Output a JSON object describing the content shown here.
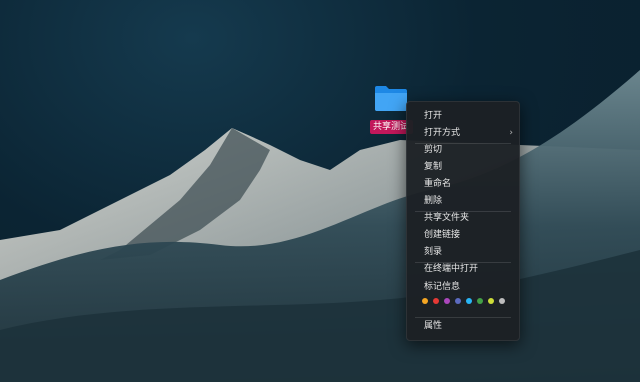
{
  "desktop": {
    "file": {
      "icon": "folder-icon",
      "label": "共享测试"
    }
  },
  "context_menu": {
    "items": [
      {
        "label": "打开"
      },
      {
        "label": "打开方式",
        "has_submenu": true,
        "submenu_icon": "chevron-right-icon"
      },
      {
        "label": "剪切"
      },
      {
        "label": "复制"
      },
      {
        "label": "重命名"
      },
      {
        "label": "删除"
      },
      {
        "label": "共享文件夹"
      },
      {
        "label": "创建链接"
      },
      {
        "label": "刻录"
      },
      {
        "label": "在终端中打开"
      },
      {
        "label": "标记信息"
      },
      {
        "label": "属性"
      }
    ],
    "tag_colors": [
      "#f5a623",
      "#e53935",
      "#ab47bc",
      "#5c6bc0",
      "#29b6f6",
      "#43a047",
      "#cddc39",
      "#bdbdbd"
    ]
  }
}
